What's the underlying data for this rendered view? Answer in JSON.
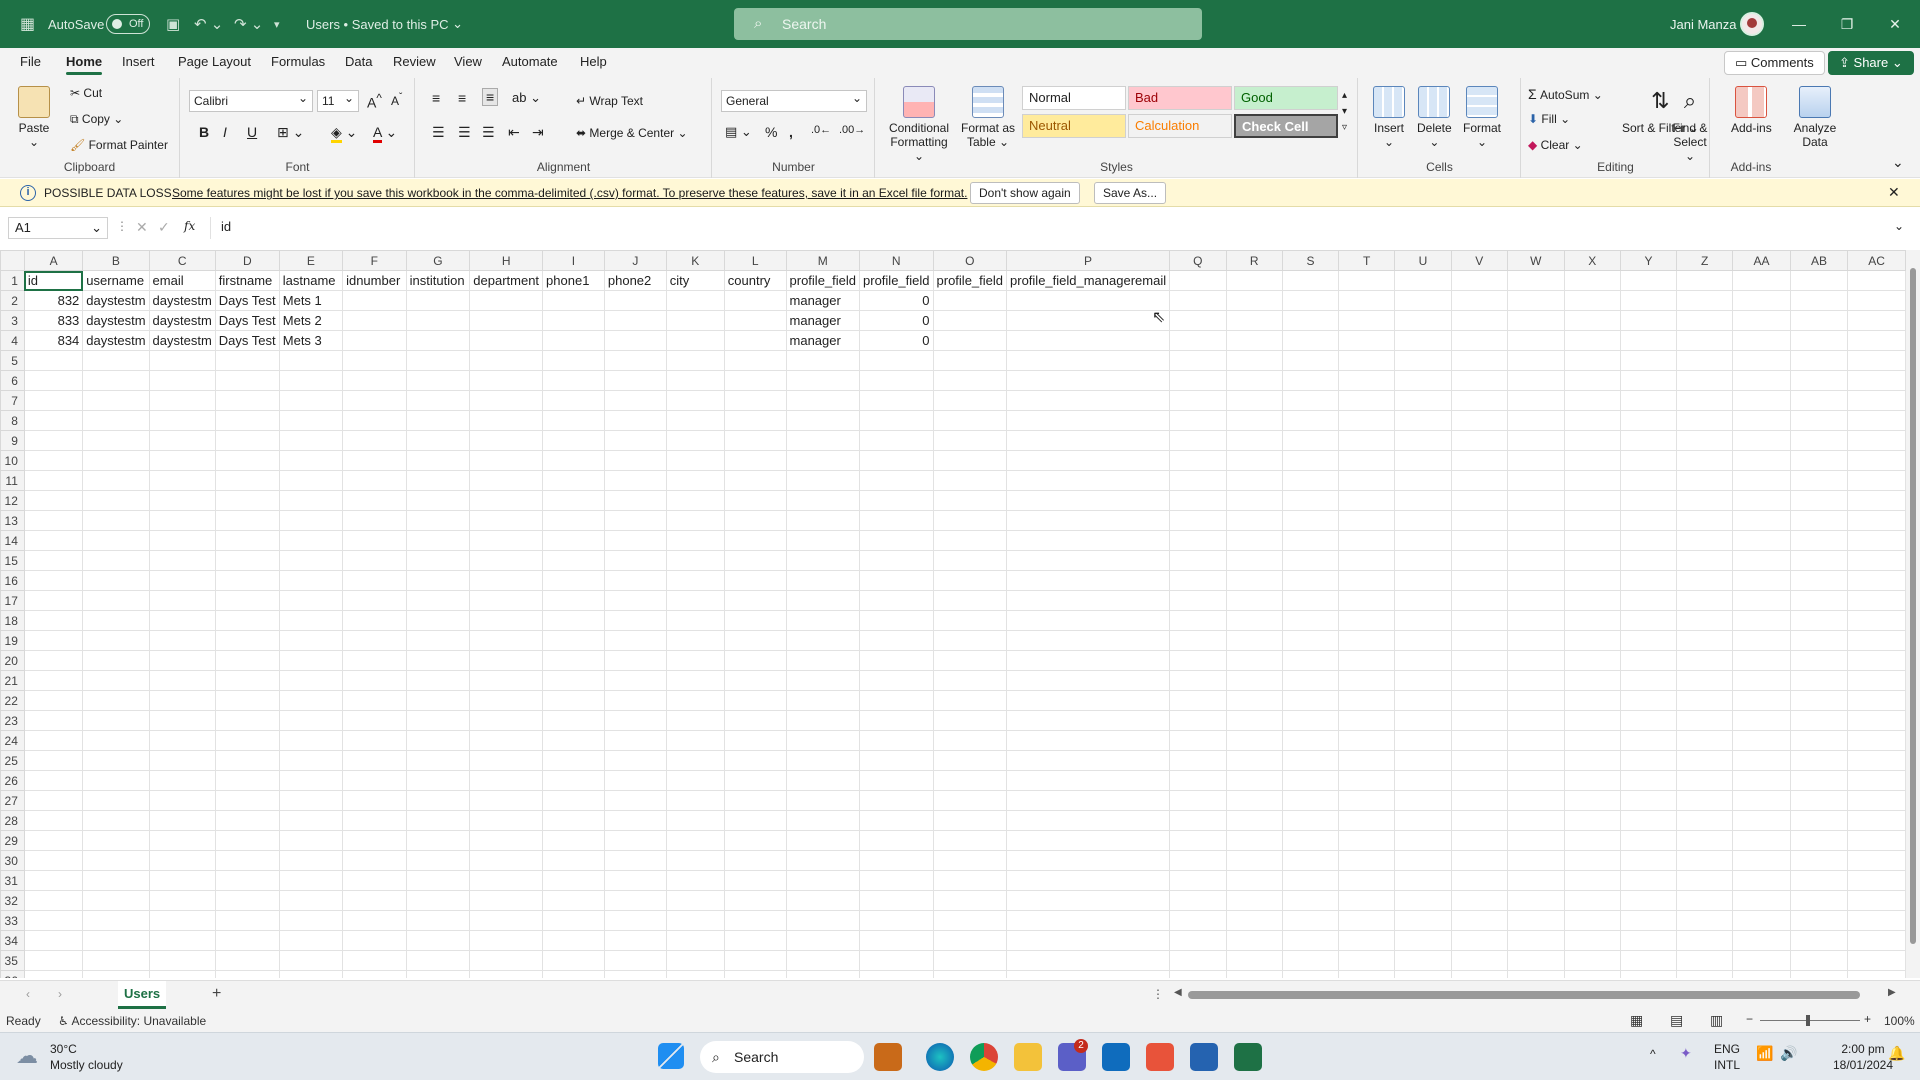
{
  "titlebar": {
    "autosave_label": "AutoSave",
    "autosave_state": "Off",
    "doc_title": "Users • Saved to this PC",
    "search_placeholder": "Search",
    "user_name": "Jani Manza"
  },
  "menu": {
    "tabs": [
      "File",
      "Home",
      "Insert",
      "Page Layout",
      "Formulas",
      "Data",
      "Review",
      "View",
      "Automate",
      "Help"
    ],
    "active": "Home",
    "comments_label": "Comments",
    "share_label": "Share"
  },
  "ribbon": {
    "clipboard": {
      "label": "Clipboard",
      "paste": "Paste",
      "cut": "Cut",
      "copy": "Copy",
      "format_painter": "Format Painter"
    },
    "font": {
      "label": "Font",
      "font_name": "Calibri",
      "font_size": "11",
      "bold": "B",
      "italic": "I",
      "underline": "U"
    },
    "alignment": {
      "label": "Alignment",
      "wrap_text": "Wrap Text",
      "merge_center": "Merge & Center"
    },
    "number": {
      "label": "Number",
      "format": "General"
    },
    "styles": {
      "label": "Styles",
      "conditional_formatting": "Conditional Formatting",
      "format_as_table": "Format as Table",
      "cells": [
        {
          "name": "Normal",
          "bg": "#ffffff",
          "fg": "#222222"
        },
        {
          "name": "Bad",
          "bg": "#ffc7ce",
          "fg": "#9c0006"
        },
        {
          "name": "Good",
          "bg": "#c6efce",
          "fg": "#006100"
        },
        {
          "name": "Neutral",
          "bg": "#ffeb9c",
          "fg": "#9c5700"
        },
        {
          "name": "Calculation",
          "bg": "#f2f2f2",
          "fg": "#fa7d00"
        },
        {
          "name": "Check Cell",
          "bg": "#a5a5a5",
          "fg": "#ffffff"
        }
      ]
    },
    "cells": {
      "label": "Cells",
      "insert": "Insert",
      "delete": "Delete",
      "format": "Format"
    },
    "editing": {
      "label": "Editing",
      "autosum": "AutoSum",
      "fill": "Fill",
      "clear": "Clear",
      "sort_filter": "Sort & Filter",
      "find_select": "Find & Select"
    },
    "addins": {
      "label": "Add-ins",
      "addins": "Add-ins",
      "analyze": "Analyze Data"
    }
  },
  "message_bar": {
    "title": "POSSIBLE DATA LOSS",
    "text": "Some features might be lost if you save this workbook in the comma-delimited (.csv) format. To preserve these features, save it in an Excel file format.",
    "dont_show": "Don't show again",
    "save_as": "Save As..."
  },
  "formula_bar": {
    "name_box": "A1",
    "fx": "fx",
    "value": "id"
  },
  "sheet": {
    "columns": [
      "A",
      "B",
      "C",
      "D",
      "E",
      "F",
      "G",
      "H",
      "I",
      "J",
      "K",
      "L",
      "M",
      "N",
      "O",
      "P",
      "Q",
      "R",
      "S",
      "T",
      "U",
      "V",
      "W",
      "X",
      "Y",
      "Z",
      "AA",
      "AB",
      "AC"
    ],
    "row_count": 36,
    "rows": [
      [
        "id",
        "username",
        "email",
        "firstname",
        "lastname",
        "idnumber",
        "institution",
        "department",
        "phone1",
        "phone2",
        "city",
        "country",
        "profile_field",
        "profile_field",
        "profile_field",
        "profile_field_manageremail",
        "",
        "",
        ""
      ],
      [
        "832",
        "daystestm",
        "daystestm",
        "Days Test",
        "Mets 1",
        "",
        "",
        "",
        "",
        "",
        "",
        "",
        "manager",
        "0",
        "",
        "",
        "",
        "",
        ""
      ],
      [
        "833",
        "daystestm",
        "daystestm",
        "Days Test",
        "Mets 2",
        "",
        "",
        "",
        "",
        "",
        "",
        "",
        "manager",
        "0",
        "",
        "",
        "",
        "",
        ""
      ],
      [
        "834",
        "daystestm",
        "daystestm",
        "Days Test",
        "Mets 3",
        "",
        "",
        "",
        "",
        "",
        "",
        "",
        "manager",
        "0",
        "",
        "",
        "",
        "",
        ""
      ]
    ]
  },
  "sheet_tabs": {
    "active": "Users",
    "add": "+"
  },
  "status": {
    "ready": "Ready",
    "accessibility": "Accessibility: Unavailable",
    "zoom": "100%"
  },
  "taskbar": {
    "weather_temp": "30°C",
    "weather_desc": "Mostly cloudy",
    "search": "Search",
    "badge": "2",
    "lang1": "ENG",
    "lang2": "INTL",
    "time": "2:00 pm",
    "date": "18/01/2024"
  }
}
